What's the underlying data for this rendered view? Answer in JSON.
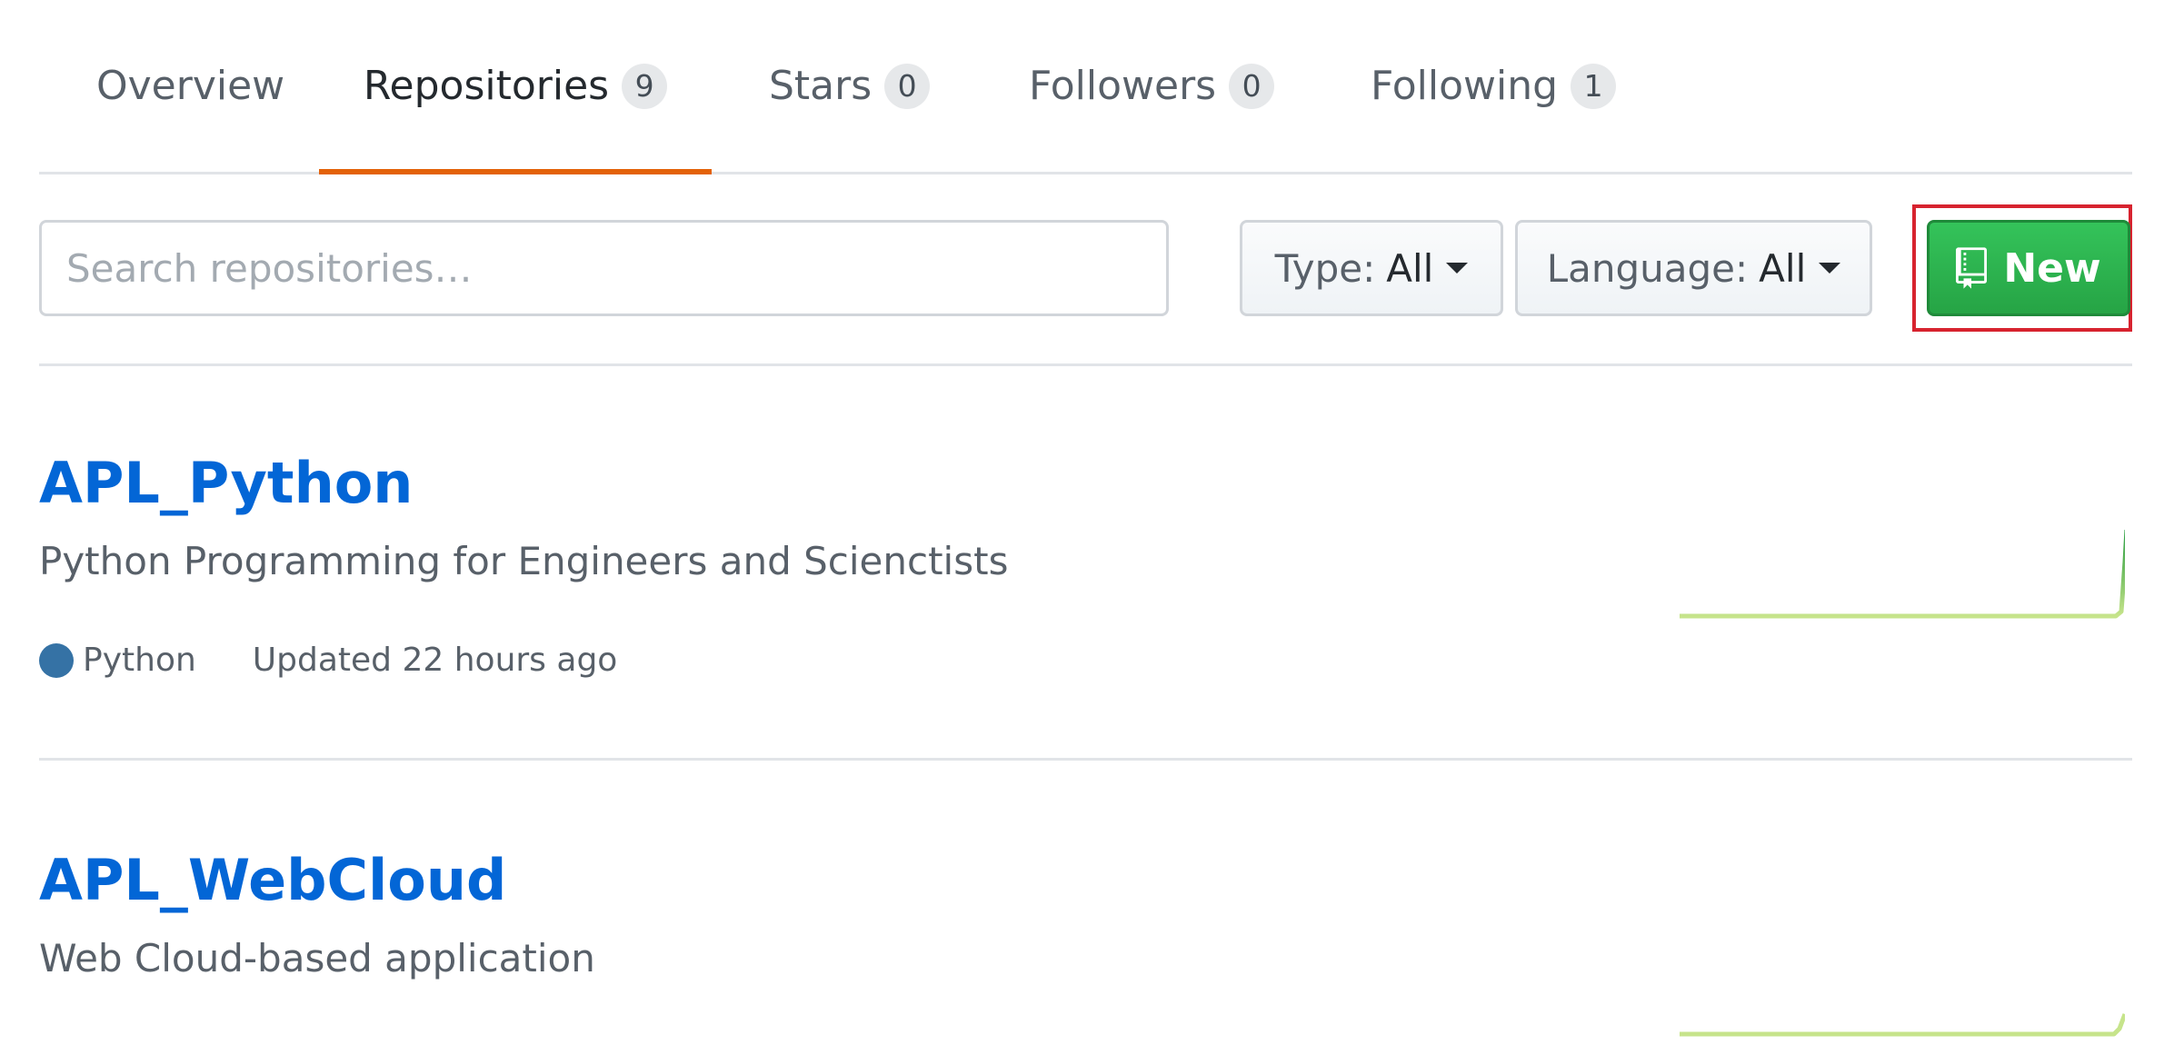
{
  "tabs": [
    {
      "label": "Overview",
      "count": null,
      "selected": false
    },
    {
      "label": "Repositories",
      "count": "9",
      "selected": true
    },
    {
      "label": "Stars",
      "count": "0",
      "selected": false
    },
    {
      "label": "Followers",
      "count": "0",
      "selected": false
    },
    {
      "label": "Following",
      "count": "1",
      "selected": false
    }
  ],
  "filters": {
    "search_placeholder": "Search repositories…",
    "search_value": "",
    "type_label": "Type:",
    "type_value": "All",
    "language_label": "Language:",
    "language_value": "All",
    "new_label": "New",
    "new_icon": "repo-icon",
    "caret_icon": "caret-down-icon"
  },
  "repos": [
    {
      "name": "APL_Python",
      "description": "Python Programming for Engineers and Scienctists",
      "language": "Python",
      "language_color": "#3572A5",
      "updated": "Updated 22 hours ago"
    },
    {
      "name": "APL_WebCloud",
      "description": "Web Cloud-based application"
    }
  ],
  "colors": {
    "accent_tab": "#e36209",
    "link": "#0366d6",
    "new_button": "#28a745",
    "highlight_box": "#d7232f",
    "sparkline_light": "#c6e48b",
    "sparkline_dark": "#7bc96f"
  }
}
